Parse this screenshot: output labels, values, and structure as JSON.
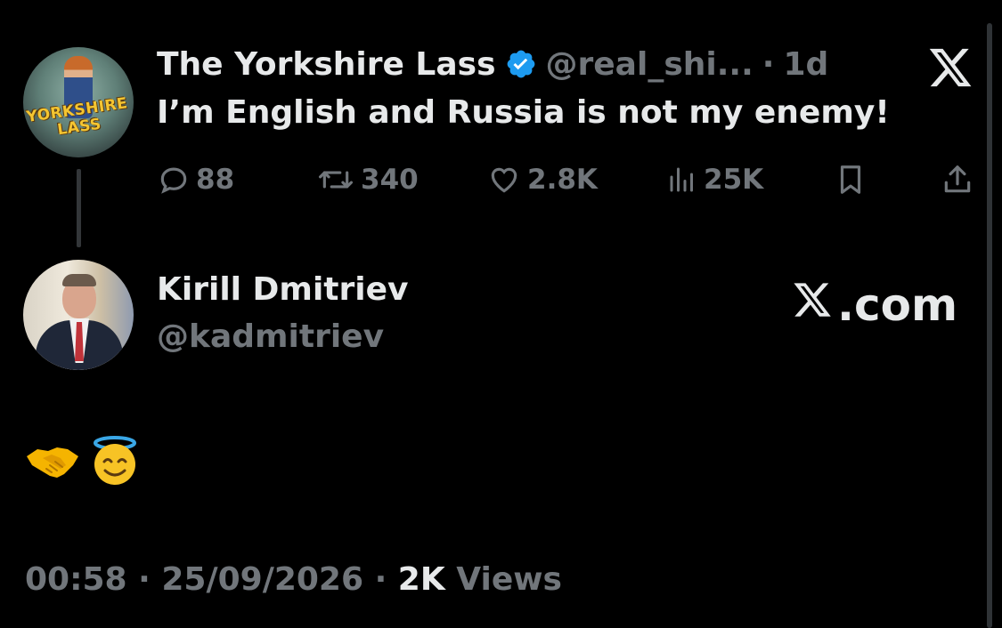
{
  "parent_tweet": {
    "avatar_text": "YORKSHIRE LASS",
    "author_name": "The Yorkshire Lass",
    "handle": "@real_shi...",
    "separator": "·",
    "time_ago": "1d",
    "text": "I’m English and Russia is not my enemy!",
    "actions": {
      "replies": "88",
      "reposts": "340",
      "likes": "2.8K",
      "views": "25K"
    }
  },
  "reply_tweet": {
    "author_name": "Kirill Dmitriev",
    "handle": "@kadmitriev",
    "emoji_text": "🤝 😇",
    "brand_text": ".com",
    "meta": {
      "time": "00:58",
      "sep1": " · ",
      "date": "25/09/2026",
      "sep2": " · ",
      "views_count": "2K",
      "views_label": " Views"
    }
  },
  "colors": {
    "background": "#000000",
    "text_primary": "#e7e9ea",
    "text_muted": "#71767b",
    "verified_blue": "#1d9bf0"
  },
  "icons": [
    "verified-icon",
    "x-logo-icon",
    "reply-icon",
    "repost-icon",
    "like-icon",
    "views-icon",
    "bookmark-icon",
    "share-icon",
    "handshake-emoji",
    "halo-smile-emoji"
  ]
}
